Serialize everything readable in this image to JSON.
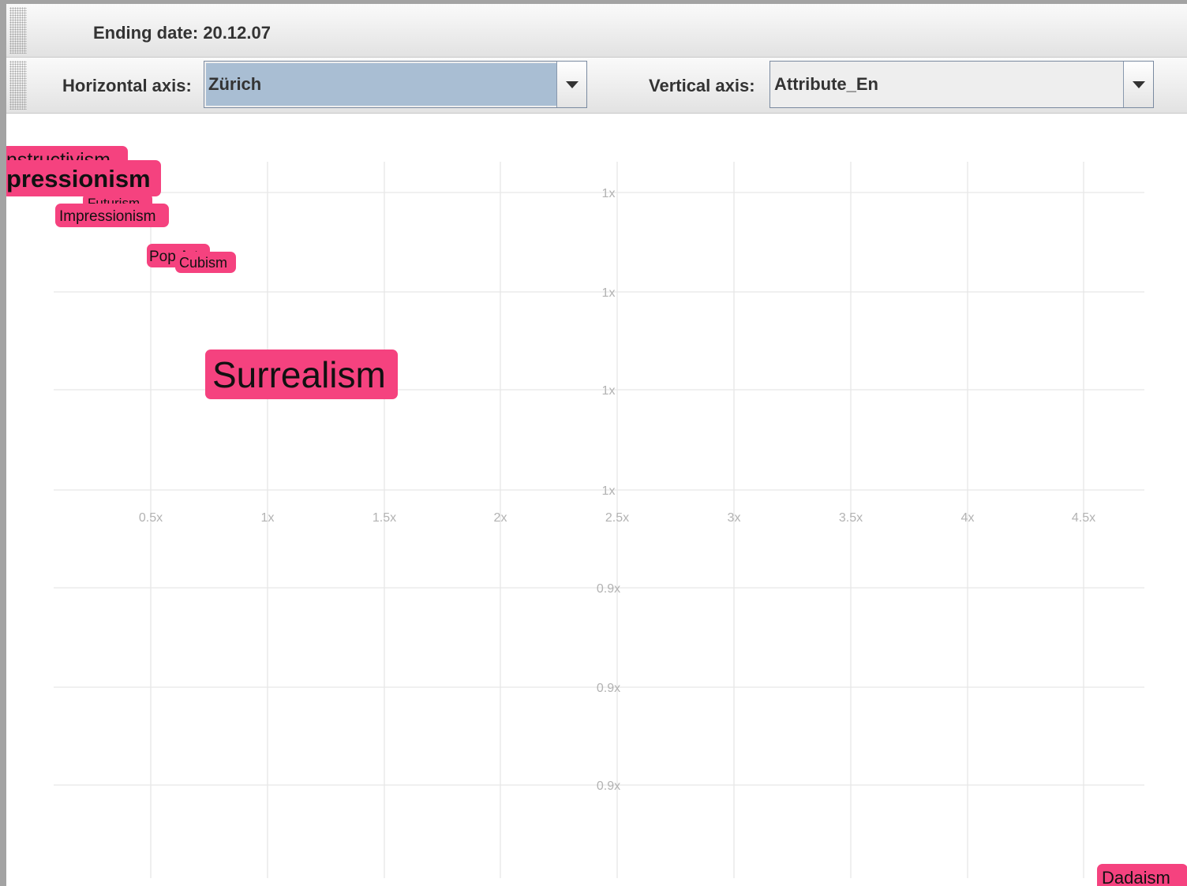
{
  "toolbar": {
    "ending_date_label": "Ending date: 20.12.07",
    "horizontal_axis_label": "Horizontal axis:",
    "horizontal_axis_value": "Zürich",
    "vertical_axis_label": "Vertical axis:",
    "vertical_axis_value": "Attribute_En"
  },
  "colors": {
    "tag_fill": "#f5427f",
    "selected_combo": "#a9bed3",
    "grid": "#e6e6e6",
    "tick_label": "#b2b2b2"
  },
  "icons": {
    "combo_arrow": "chevron-down-icon",
    "toolbar_grip": "grip-icon"
  },
  "chart_data": {
    "type": "scatter",
    "title": "",
    "xlabel": "",
    "ylabel": "",
    "grid": true,
    "x_ticks": [
      "0.5x",
      "1x",
      "1.5x",
      "2x",
      "2.5x",
      "3x",
      "3.5x",
      "4x",
      "4.5x"
    ],
    "y_ticks": [
      "1x",
      "1x",
      "1x",
      "1x",
      "0.9x",
      "0.9x",
      "0.9x"
    ],
    "points": [
      {
        "label": "nstructivism"
      },
      {
        "label": "pressionism"
      },
      {
        "label": "Futurism"
      },
      {
        "label": "Impressionism"
      },
      {
        "label": "Pop Art"
      },
      {
        "label": "Cubism"
      },
      {
        "label": "Surrealism"
      },
      {
        "label": "Dadaism"
      }
    ]
  }
}
